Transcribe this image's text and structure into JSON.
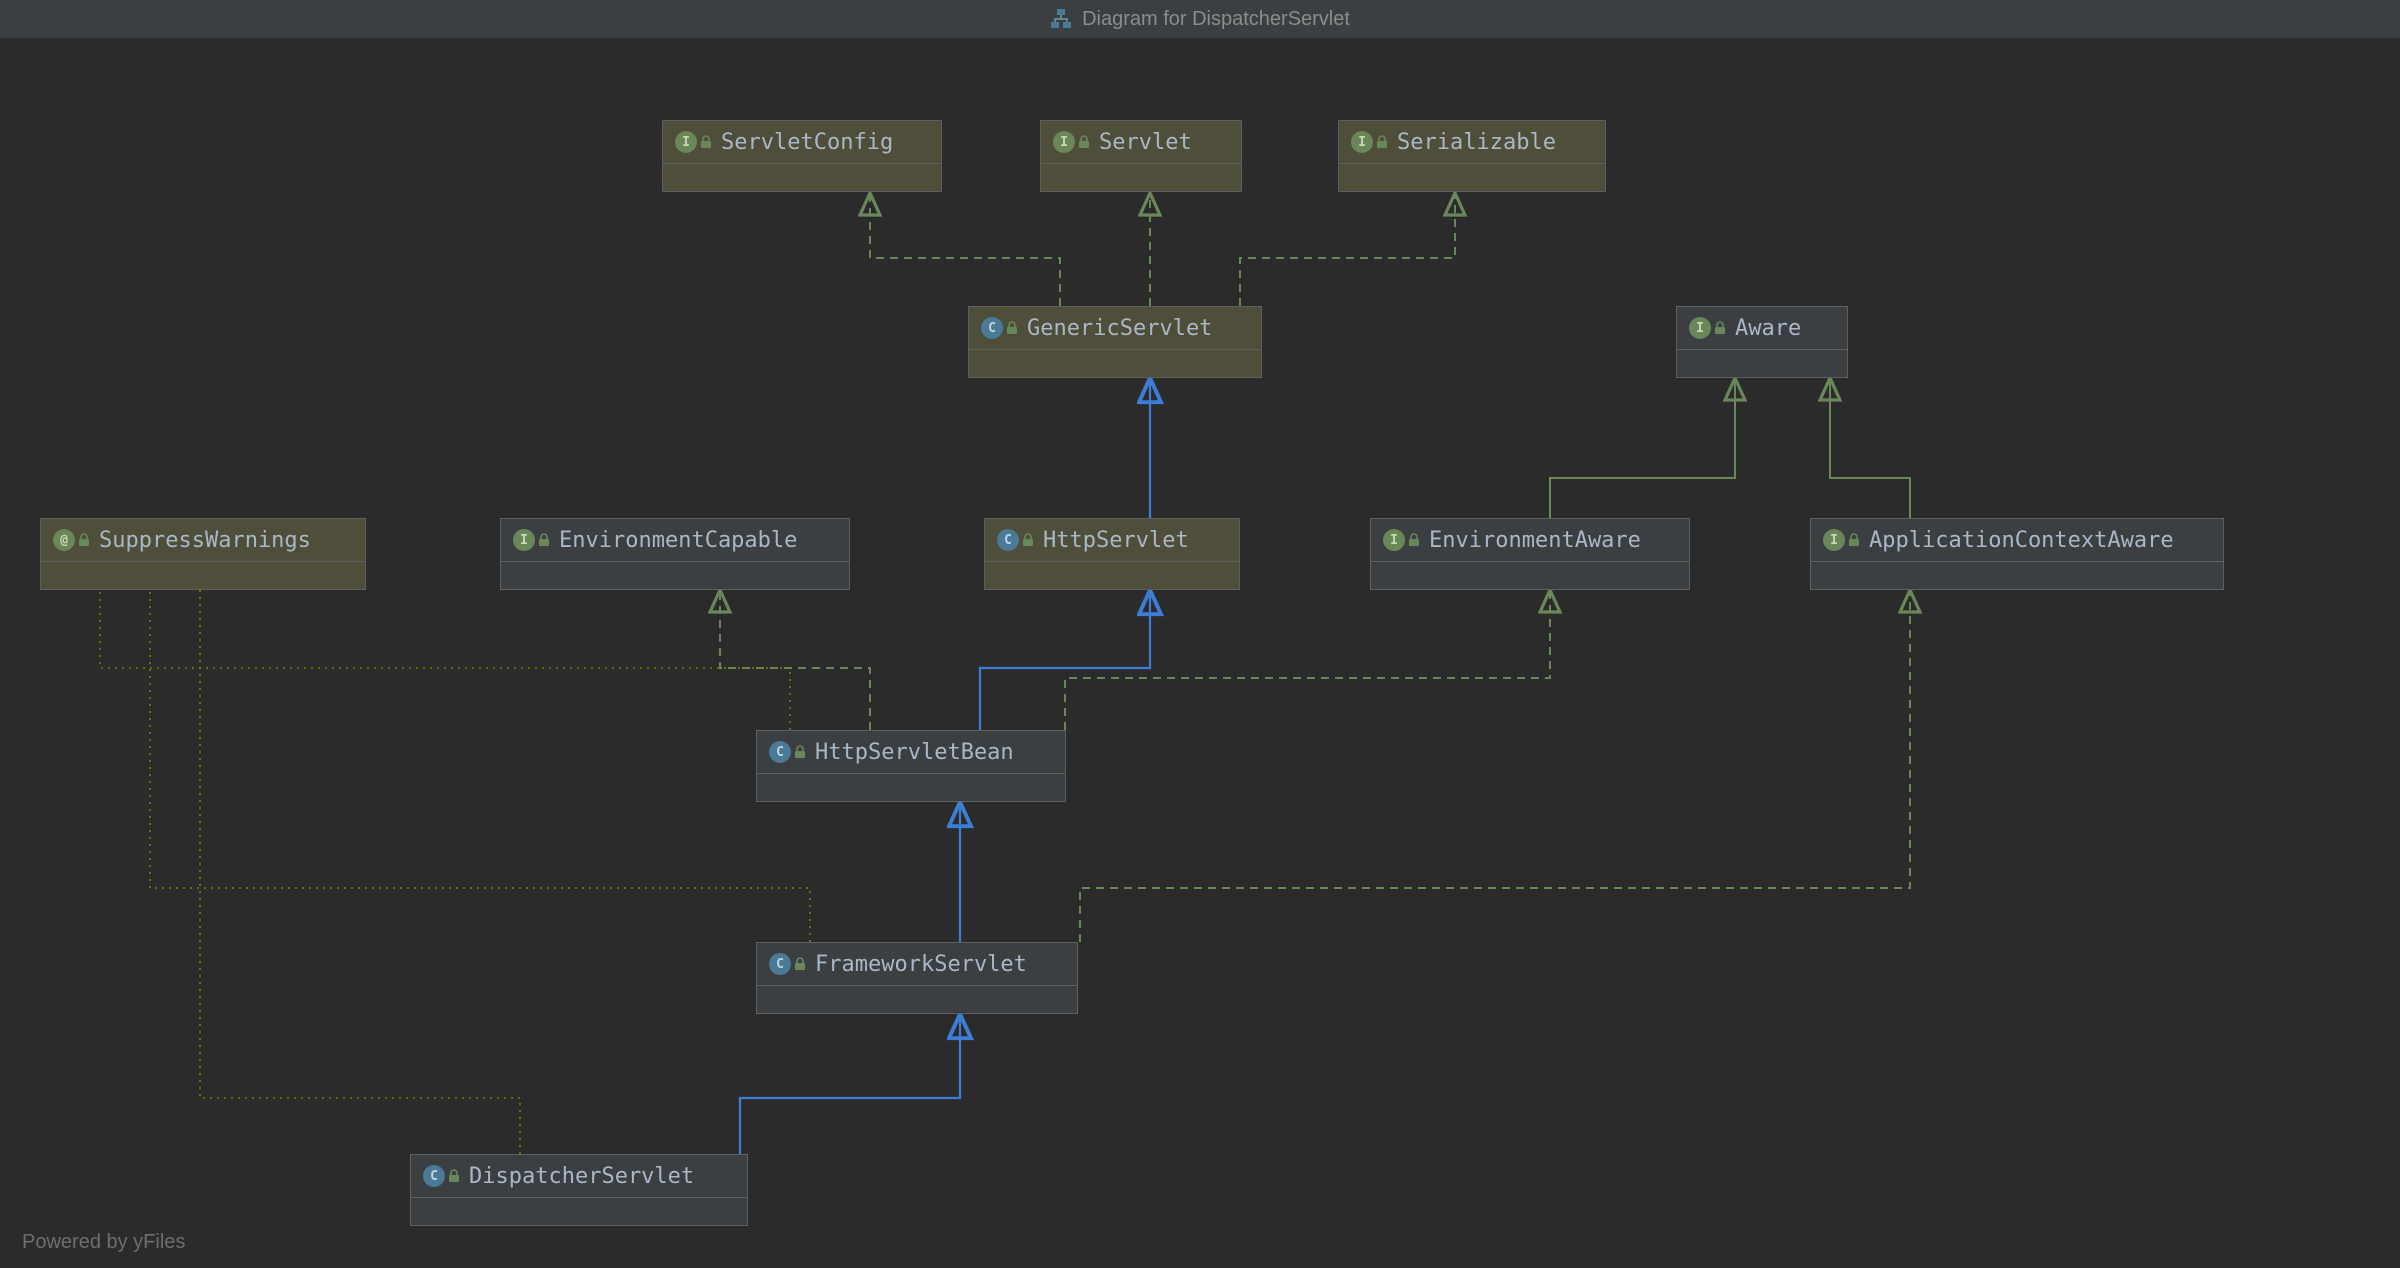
{
  "titlebar": {
    "text": "Diagram for DispatcherServlet"
  },
  "footer": {
    "text": "Powered by yFiles"
  },
  "nodes": {
    "servletConfig": {
      "label": "ServletConfig",
      "kind": "I",
      "locked": true
    },
    "servlet": {
      "label": "Servlet",
      "kind": "I",
      "locked": true
    },
    "serializable": {
      "label": "Serializable",
      "kind": "I",
      "locked": true
    },
    "genericServlet": {
      "label": "GenericServlet",
      "kind": "C",
      "locked": true
    },
    "aware": {
      "label": "Aware",
      "kind": "I",
      "locked": true
    },
    "suppressWarnings": {
      "label": "SuppressWarnings",
      "kind": "A",
      "locked": true
    },
    "environmentCapable": {
      "label": "EnvironmentCapable",
      "kind": "I",
      "locked": true
    },
    "httpServlet": {
      "label": "HttpServlet",
      "kind": "C",
      "locked": true
    },
    "environmentAware": {
      "label": "EnvironmentAware",
      "kind": "I",
      "locked": true
    },
    "applicationContextAware": {
      "label": "ApplicationContextAware",
      "kind": "I",
      "locked": true
    },
    "httpServletBean": {
      "label": "HttpServletBean",
      "kind": "C",
      "locked": true
    },
    "frameworkServlet": {
      "label": "FrameworkServlet",
      "kind": "C",
      "locked": true
    },
    "dispatcherServlet": {
      "label": "DispatcherServlet",
      "kind": "C",
      "locked": true
    }
  },
  "chart_data": {
    "type": "uml-class-diagram",
    "title": "Diagram for DispatcherServlet",
    "nodes": [
      {
        "id": "ServletConfig",
        "type": "interface",
        "locked": true
      },
      {
        "id": "Servlet",
        "type": "interface",
        "locked": true
      },
      {
        "id": "Serializable",
        "type": "interface",
        "locked": true
      },
      {
        "id": "GenericServlet",
        "type": "class",
        "locked": true
      },
      {
        "id": "Aware",
        "type": "interface",
        "locked": true
      },
      {
        "id": "SuppressWarnings",
        "type": "annotation",
        "locked": true
      },
      {
        "id": "EnvironmentCapable",
        "type": "interface",
        "locked": true
      },
      {
        "id": "HttpServlet",
        "type": "class",
        "locked": true
      },
      {
        "id": "EnvironmentAware",
        "type": "interface",
        "locked": true
      },
      {
        "id": "ApplicationContextAware",
        "type": "interface",
        "locked": true
      },
      {
        "id": "HttpServletBean",
        "type": "class",
        "locked": true
      },
      {
        "id": "FrameworkServlet",
        "type": "class",
        "locked": true
      },
      {
        "id": "DispatcherServlet",
        "type": "class",
        "locked": true
      }
    ],
    "edges": [
      {
        "from": "GenericServlet",
        "to": "ServletConfig",
        "relation": "implements"
      },
      {
        "from": "GenericServlet",
        "to": "Servlet",
        "relation": "implements"
      },
      {
        "from": "GenericServlet",
        "to": "Serializable",
        "relation": "implements"
      },
      {
        "from": "HttpServlet",
        "to": "GenericServlet",
        "relation": "extends"
      },
      {
        "from": "EnvironmentAware",
        "to": "Aware",
        "relation": "extends-interface"
      },
      {
        "from": "ApplicationContextAware",
        "to": "Aware",
        "relation": "extends-interface"
      },
      {
        "from": "HttpServletBean",
        "to": "HttpServlet",
        "relation": "extends"
      },
      {
        "from": "HttpServletBean",
        "to": "EnvironmentCapable",
        "relation": "implements"
      },
      {
        "from": "HttpServletBean",
        "to": "EnvironmentAware",
        "relation": "implements"
      },
      {
        "from": "HttpServletBean",
        "to": "SuppressWarnings",
        "relation": "annotated-by"
      },
      {
        "from": "FrameworkServlet",
        "to": "HttpServletBean",
        "relation": "extends"
      },
      {
        "from": "FrameworkServlet",
        "to": "ApplicationContextAware",
        "relation": "implements"
      },
      {
        "from": "FrameworkServlet",
        "to": "SuppressWarnings",
        "relation": "annotated-by"
      },
      {
        "from": "DispatcherServlet",
        "to": "FrameworkServlet",
        "relation": "extends"
      },
      {
        "from": "DispatcherServlet",
        "to": "SuppressWarnings",
        "relation": "annotated-by"
      }
    ],
    "legend": {
      "extends": "solid blue arrow",
      "implements": "dashed green arrow",
      "extends-interface": "solid green arrow",
      "annotated-by": "dotted olive line"
    }
  }
}
